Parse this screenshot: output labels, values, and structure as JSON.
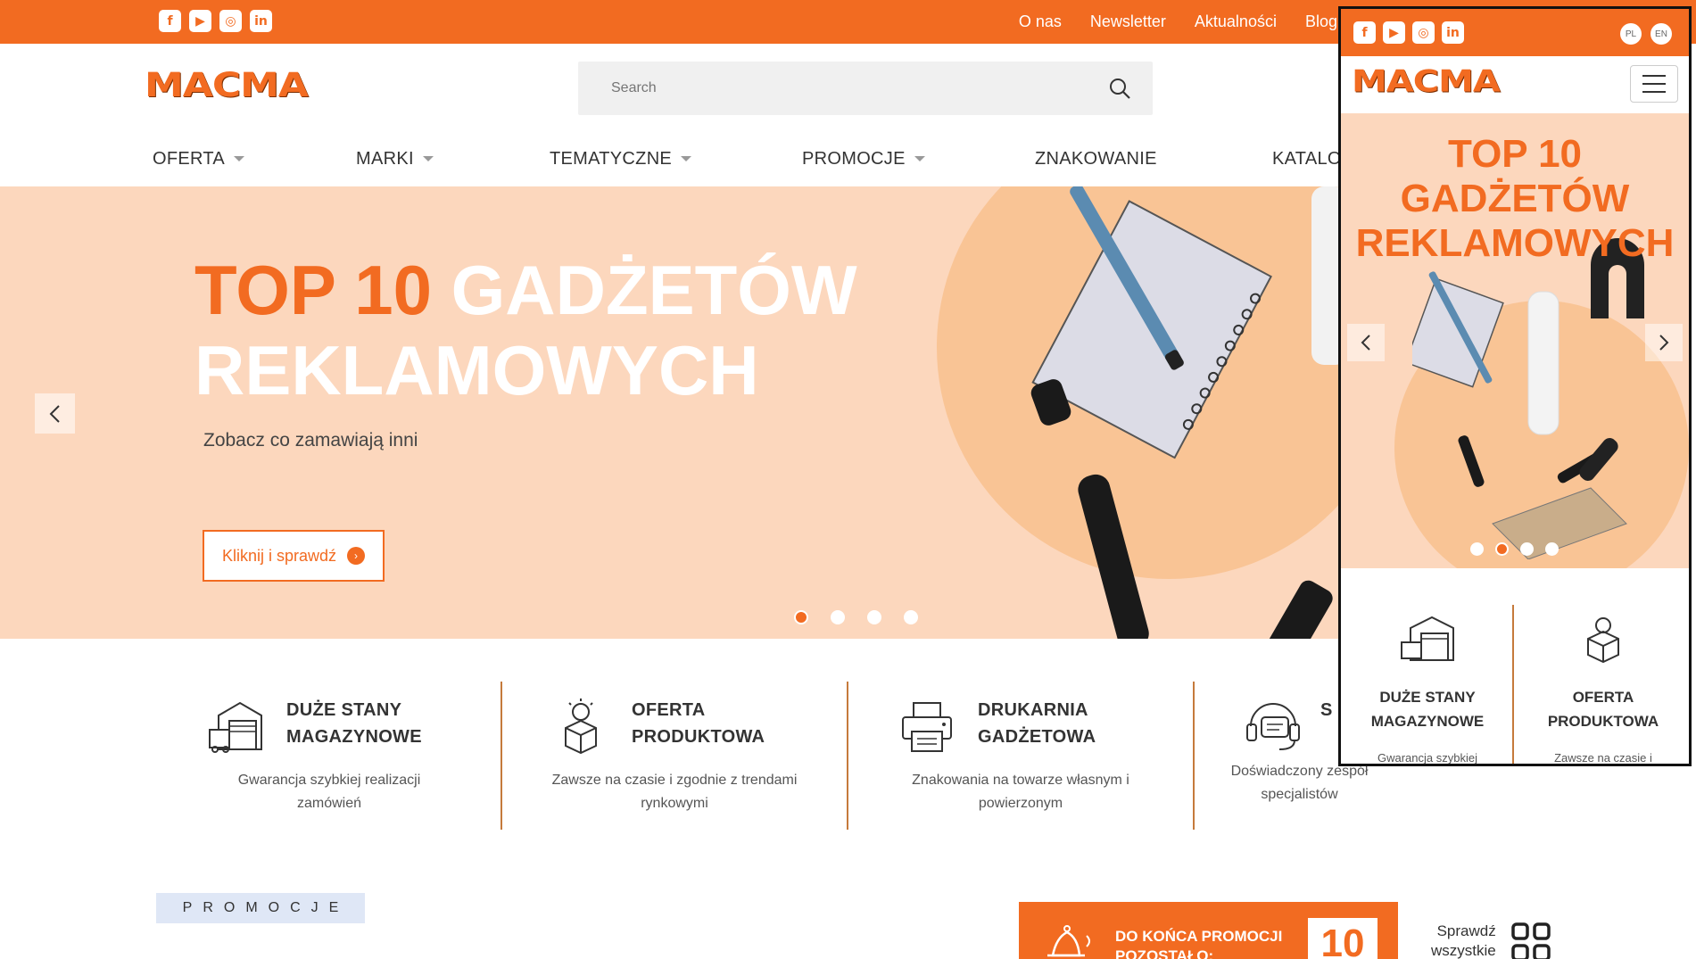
{
  "topbar": {
    "social_icons": [
      "facebook-icon",
      "youtube-icon",
      "instagram-icon",
      "linkedin-icon"
    ],
    "links": [
      "O nas",
      "Newsletter",
      "Aktualności",
      "Blog"
    ]
  },
  "header": {
    "logo_text": "MACMA",
    "search": {
      "placeholder": "Search",
      "value": ""
    }
  },
  "nav": [
    {
      "label": "OFERTA",
      "dropdown": true
    },
    {
      "label": "MARKI",
      "dropdown": true
    },
    {
      "label": "TEMATYCZNE",
      "dropdown": true
    },
    {
      "label": "PROMOCJE",
      "dropdown": true
    },
    {
      "label": "ZNAKOWANIE",
      "dropdown": false
    },
    {
      "label": "KATALO",
      "dropdown": false
    }
  ],
  "hero": {
    "title_accent": "TOP 10",
    "title_rest": "GADŻETÓW",
    "title_line2": "REKLAMOWYCH",
    "subtitle": "Zobacz co zamawiają inni",
    "button_label": "Kliknij i sprawdź",
    "active_slide": 1,
    "slide_count": 4
  },
  "features": [
    {
      "icon": "warehouse-icon",
      "title_line1": "DUŻE STANY",
      "title_line2": "MAGAZYNOWE",
      "desc_line1": "Gwarancja szybkiej realizacji",
      "desc_line2": "zamówień"
    },
    {
      "icon": "lightbulb-box-icon",
      "title_line1": "OFERTA",
      "title_line2": "PRODUKTOWA",
      "desc_line1": "Zawsze na czasie i zgodnie z trendami",
      "desc_line2": "rynkowymi"
    },
    {
      "icon": "printer-icon",
      "title_line1": "DRUKARNIA",
      "title_line2": "GADŻETOWA",
      "desc_line1": "Znakowania na towarze własnym i",
      "desc_line2": "powierzonym"
    },
    {
      "icon": "support-headset-icon",
      "title_line1": "S",
      "title_line2": "",
      "desc_line1": "Doświadczony zespół",
      "desc_line2": "specjalistów"
    }
  ],
  "promo": {
    "label": "PROMOCJE",
    "countdown_line1": "DO KOŃCA PROMOCJI",
    "countdown_line2": "POZOSTAŁO:",
    "countdown_value": "10",
    "see_all_line1": "Sprawdź",
    "see_all_line2": "wszystkie"
  },
  "mobile": {
    "languages": [
      "PL",
      "EN"
    ],
    "title_line1": "TOP 10 GADŻETÓW",
    "title_line2": "REKLAMOWYCH",
    "active_slide": 2,
    "features": [
      {
        "title_line1": "DUŻE STANY",
        "title_line2": "MAGAZYNOWE",
        "desc": "Gwarancja szybkiej"
      },
      {
        "title_line1": "OFERTA",
        "title_line2": "PRODUKTOWA",
        "desc": "Zawsze na czasie i"
      }
    ]
  },
  "colors": {
    "brand": "#f26b21",
    "hero_bg": "#fcd7bd",
    "promo_label_bg": "#dfe7f6",
    "separator": "#c57a3c"
  }
}
